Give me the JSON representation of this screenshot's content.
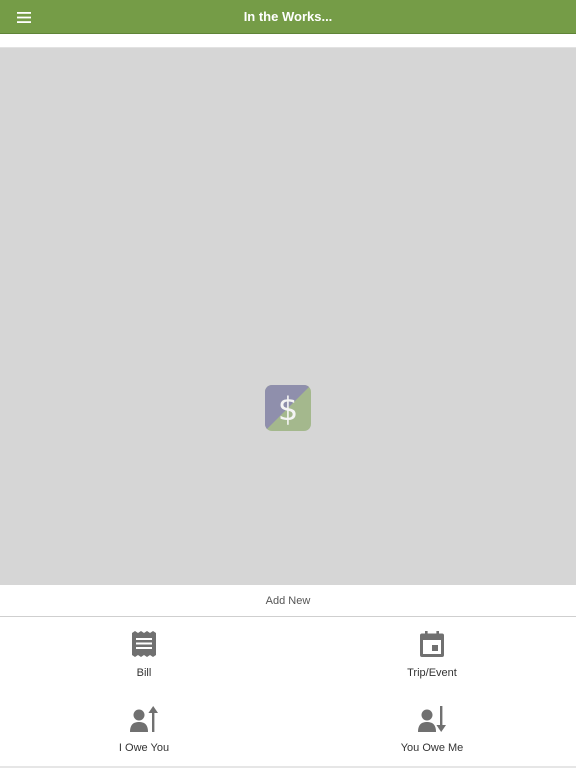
{
  "header": {
    "title": "In the Works...",
    "menu_icon": "hamburger-menu-icon",
    "background_color": "#759c47"
  },
  "main": {
    "background_color": "#d6d6d6",
    "logo_glyph": "$",
    "logo_colors": [
      "#8f8fac",
      "#a4b88d"
    ]
  },
  "add_new": {
    "label": "Add New",
    "options": [
      {
        "label": "Bill",
        "icon": "receipt-icon"
      },
      {
        "label": "Trip/Event",
        "icon": "calendar-icon"
      },
      {
        "label": "I Owe You",
        "icon": "person-arrow-up-icon"
      },
      {
        "label": "You Owe Me",
        "icon": "person-arrow-down-icon"
      }
    ]
  }
}
